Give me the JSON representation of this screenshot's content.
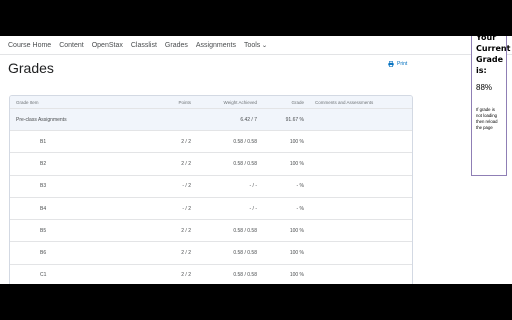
{
  "nav": {
    "items": [
      "Course Home",
      "Content",
      "OpenStax",
      "Classlist",
      "Grades",
      "Assignments"
    ],
    "tools_label": "Tools"
  },
  "page": {
    "title": "Grades",
    "print_label": "Print"
  },
  "table": {
    "headers": {
      "item": "Grade Item",
      "points": "Points",
      "weight": "Weight Achieved",
      "grade": "Grade",
      "comments": "Comments and Assessments"
    },
    "category": {
      "item": "Pre-class Assignments",
      "points": "",
      "weight": "6.42 / 7",
      "grade": "91.67 %",
      "comments": ""
    },
    "rows": [
      {
        "item": "B1",
        "points": "2 / 2",
        "weight": "0.58 / 0.58",
        "grade": "100 %"
      },
      {
        "item": "B2",
        "points": "2 / 2",
        "weight": "0.58 / 0.58",
        "grade": "100 %"
      },
      {
        "item": "B3",
        "points": "- / 2",
        "weight": "- / -",
        "grade": "- %"
      },
      {
        "item": "B4",
        "points": "- / 2",
        "weight": "- / -",
        "grade": "- %"
      },
      {
        "item": "B5",
        "points": "2 / 2",
        "weight": "0.58 / 0.58",
        "grade": "100 %"
      },
      {
        "item": "B6",
        "points": "2 / 2",
        "weight": "0.58 / 0.58",
        "grade": "100 %"
      },
      {
        "item": "C1",
        "points": "2 / 2",
        "weight": "0.58 / 0.58",
        "grade": "100 %"
      }
    ]
  },
  "side_panel": {
    "heading": "Your Current Grade is:",
    "grade": "88%",
    "note": "If grade is not loading then reload the page"
  }
}
